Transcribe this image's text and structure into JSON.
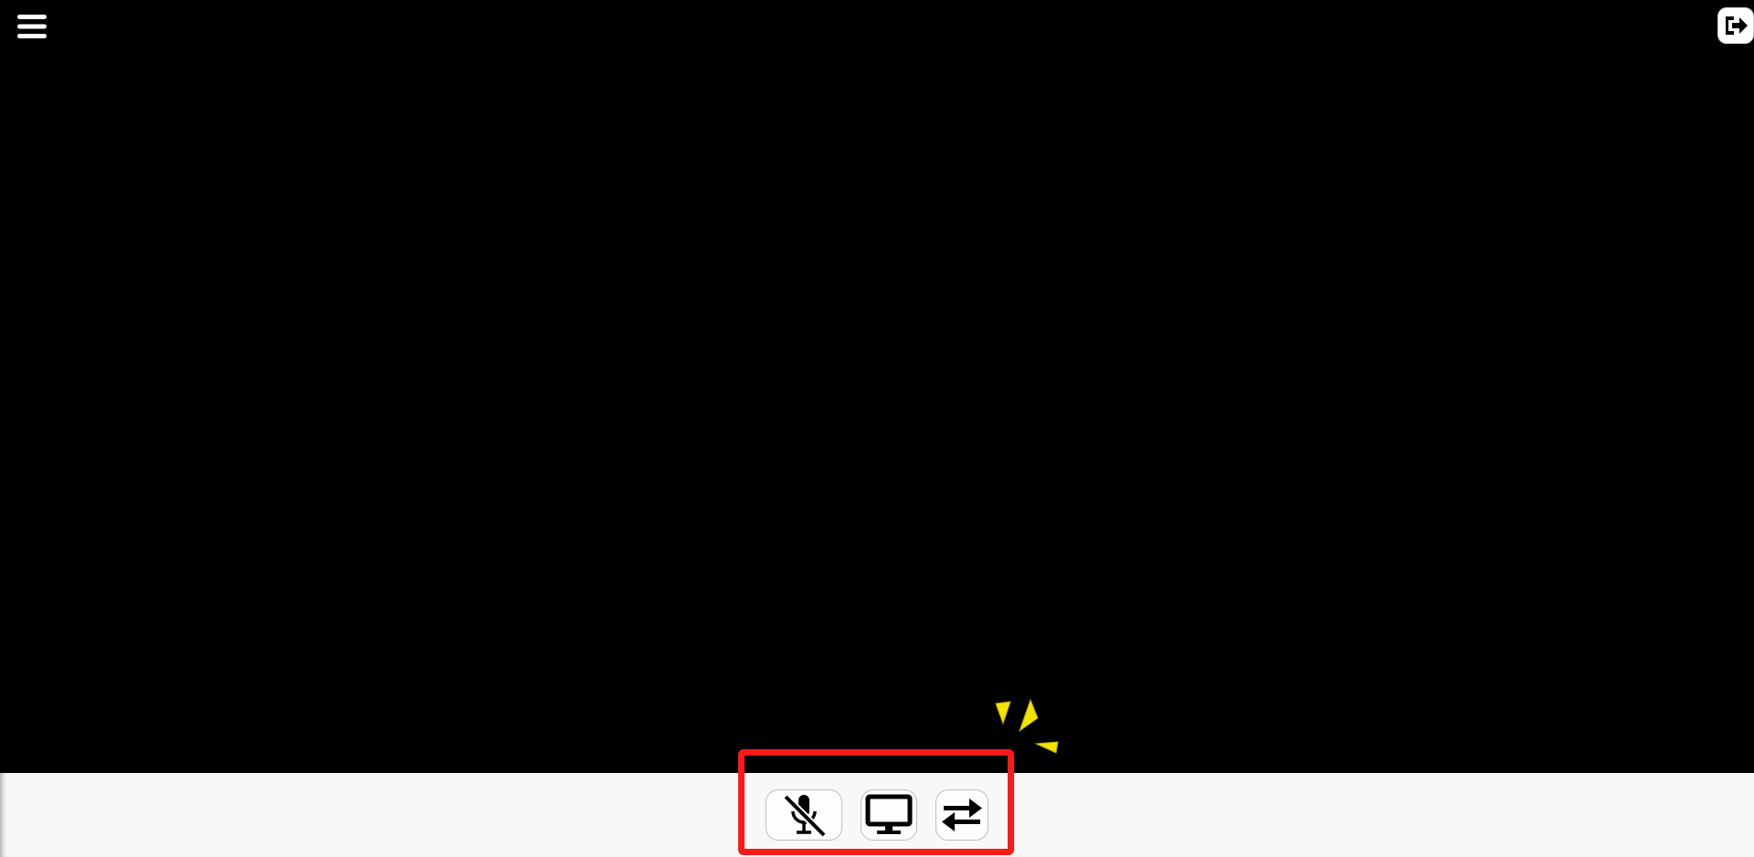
{
  "app": {
    "topbar": {
      "menu_icon": "hamburger-menu-icon",
      "exit_icon": "exit-door-arrow-icon"
    },
    "video_area": {
      "background": "#000000"
    },
    "controls": {
      "mic": {
        "icon": "microphone-muted-icon",
        "state": "muted"
      },
      "screen_share": {
        "icon": "monitor-screen-icon"
      },
      "switch": {
        "icon": "swap-arrows-icon"
      }
    },
    "annotation": {
      "highlight_color": "#ff1a1a",
      "sparkle_color": "#f2e600"
    }
  }
}
